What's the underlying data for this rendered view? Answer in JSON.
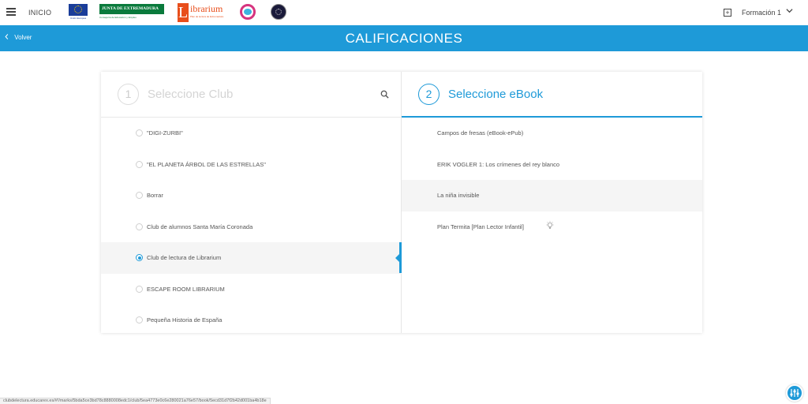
{
  "header": {
    "menu_icon": "hamburger-icon",
    "inicio_label": "INICIO",
    "logos": {
      "eu_caption": "Unión Europea",
      "junta_title": "JUNTA DE EXTREMADURA",
      "junta_sub": "Consejería de Educación y Empleo",
      "librarium_letter": "L",
      "librarium_word": "ibrarium",
      "librarium_tag": "Plan de lectura de Extremadura"
    },
    "add_icon": "plus-square-icon",
    "user_label": "Formación 1",
    "user_dropdown_icon": "chevron-down-icon"
  },
  "subheader": {
    "back_label": "Volver",
    "back_icon": "chevron-left-icon",
    "title": "CALIFICACIONES"
  },
  "steps": {
    "club": {
      "number": "1",
      "label": "Seleccione Club",
      "search_icon": "search-icon"
    },
    "ebook": {
      "number": "2",
      "label": "Seleccione eBook"
    }
  },
  "clubs": [
    {
      "label": "\"DIGI-ZURBI\"",
      "selected": false
    },
    {
      "label": "\"EL PLANETA ÁRBOL DE LAS ESTRELLAS\"",
      "selected": false
    },
    {
      "label": "Borrar",
      "selected": false
    },
    {
      "label": "Club de alumnos Santa María Coronada",
      "selected": false
    },
    {
      "label": "Club de lectura de Librarium",
      "selected": true
    },
    {
      "label": "ESCAPE ROOM LIBRARIUM",
      "selected": false
    },
    {
      "label": "Pequeña Historia de España",
      "selected": false
    }
  ],
  "books": [
    {
      "label": "Campos de fresas (eBook-ePub)",
      "highlighted": false,
      "icon": ""
    },
    {
      "label": "ERIK VOGLER 1: Los crímenes del rey blanco",
      "highlighted": false,
      "icon": ""
    },
    {
      "label": "La niña invisible",
      "highlighted": true,
      "icon": ""
    },
    {
      "label": "Plan Termita [Plan Lector Infantil]",
      "highlighted": false,
      "icon": "lightbulb-icon"
    }
  ],
  "status_bar_url": "clubdelectura.educarex.es/#!/marks/5bda5ce3bd78c8880008edc1/club/5ea4773e0c6e280021a76e57/book/5ecd31d7f2b42d001ba4b18e",
  "accessibility_icon": "accessibility-icon",
  "colors": {
    "accent": "#1e9ad8",
    "text": "#555555",
    "muted": "#d4d4d4",
    "selected_bg": "#f5f5f5"
  }
}
